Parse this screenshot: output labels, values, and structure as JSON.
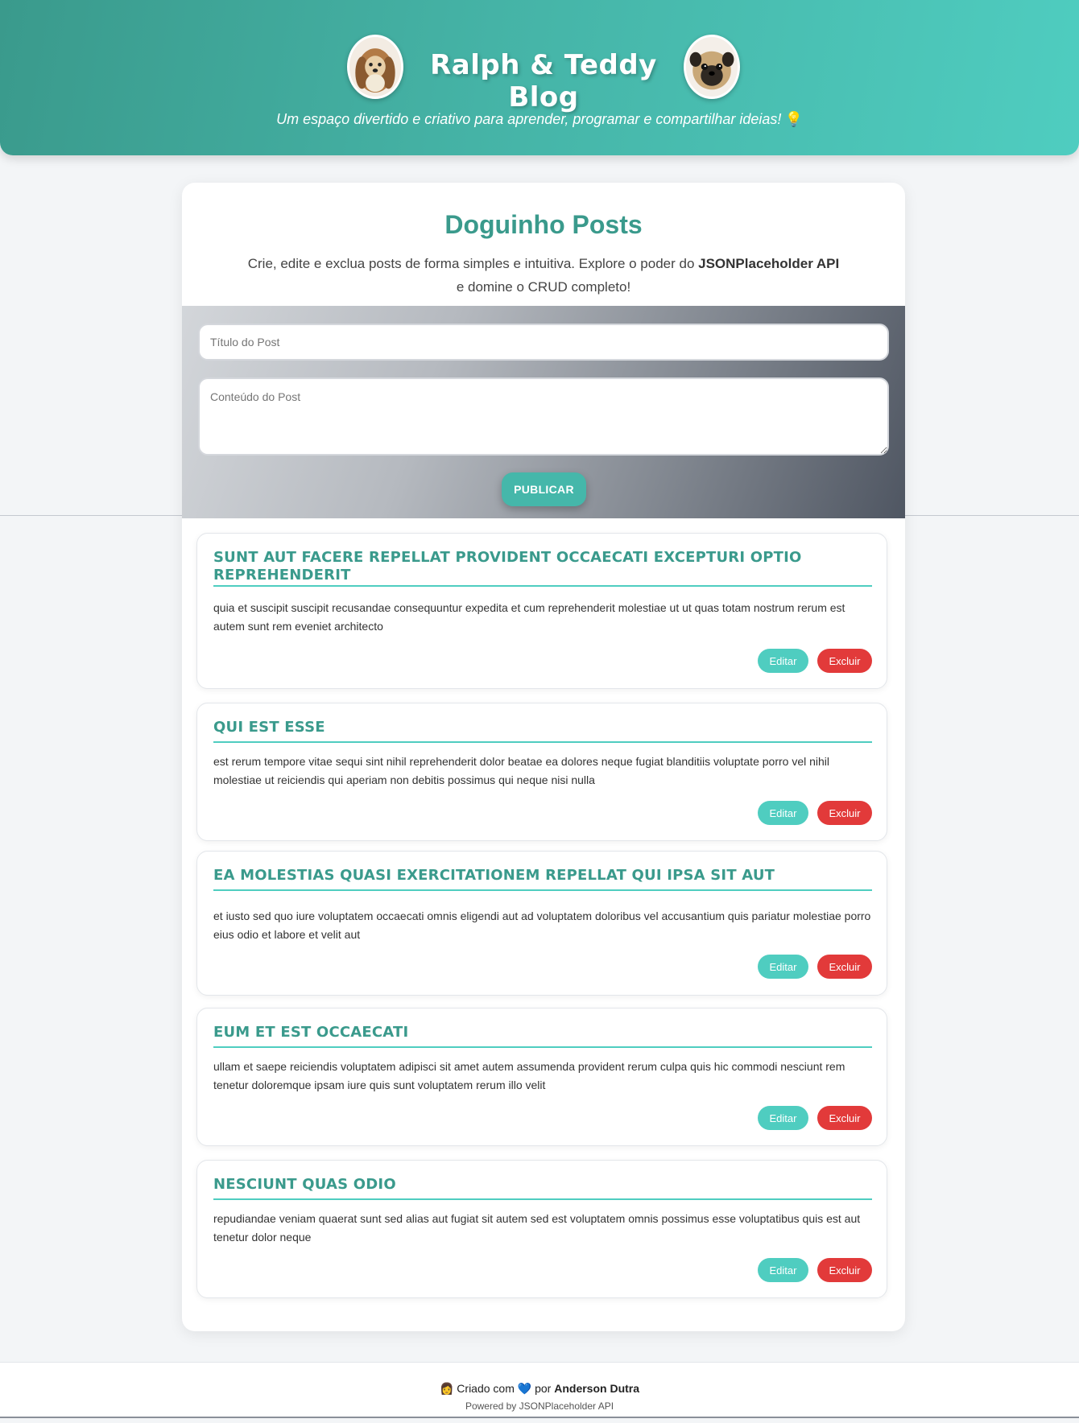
{
  "header": {
    "title": "Ralph & Teddy Blog",
    "tagline": "Um espaço divertido e criativo para aprender, programar e compartilhar ideias!",
    "bulb_icon": "💡"
  },
  "main": {
    "title": "Doguinho Posts",
    "description_pre": "Crie, edite e exclua posts de forma simples e intuitiva. Explore o poder do ",
    "description_bold": "JSONPlaceholder API",
    "description_post": "e domine o CRUD completo!"
  },
  "form": {
    "title_placeholder": "Título do Post",
    "content_placeholder": "Conteúdo do Post",
    "publish_label": "PUBLICAR"
  },
  "posts": [
    {
      "title": "sunt aut facere repellat provident occaecati excepturi optio reprehenderit",
      "body": "quia et suscipit suscipit recusandae consequuntur expedita et cum reprehenderit molestiae ut ut quas totam nostrum rerum est autem sunt rem eveniet architecto",
      "edit_label": "Editar",
      "delete_label": "Excluir"
    },
    {
      "title": "qui est esse",
      "body": "est rerum tempore vitae sequi sint nihil reprehenderit dolor beatae ea dolores neque fugiat blanditiis voluptate porro vel nihil molestiae ut reiciendis qui aperiam non debitis possimus qui neque nisi nulla",
      "edit_label": "Editar",
      "delete_label": "Excluir"
    },
    {
      "title": "ea molestias quasi exercitationem repellat qui ipsa sit aut",
      "body": "et iusto sed quo iure voluptatem occaecati omnis eligendi aut ad voluptatem doloribus vel accusantium quis pariatur molestiae porro eius odio et labore et velit aut",
      "edit_label": "Editar",
      "delete_label": "Excluir"
    },
    {
      "title": "eum et est occaecati",
      "body": "ullam et saepe reiciendis voluptatem adipisci sit amet autem assumenda provident rerum culpa quis hic commodi nesciunt rem tenetur doloremque ipsam iure quis sunt voluptatem rerum illo velit",
      "edit_label": "Editar",
      "delete_label": "Excluir"
    },
    {
      "title": "nesciunt quas odio",
      "body": "repudiandae veniam quaerat sunt sed alias aut fugiat sit autem sed est voluptatem omnis possimus esse voluptatibus quis est aut tenetur dolor neque",
      "edit_label": "Editar",
      "delete_label": "Excluir"
    }
  ],
  "footer": {
    "person_icon": "👩",
    "created_with": "Criado com",
    "heart_icon": "💙",
    "by": "por",
    "author": "Anderson Dutra",
    "powered": "Powered by JSONPlaceholder API"
  },
  "colors": {
    "accent": "#3a9a8c",
    "teal": "#4fcdc0",
    "danger": "#e23a3a"
  }
}
